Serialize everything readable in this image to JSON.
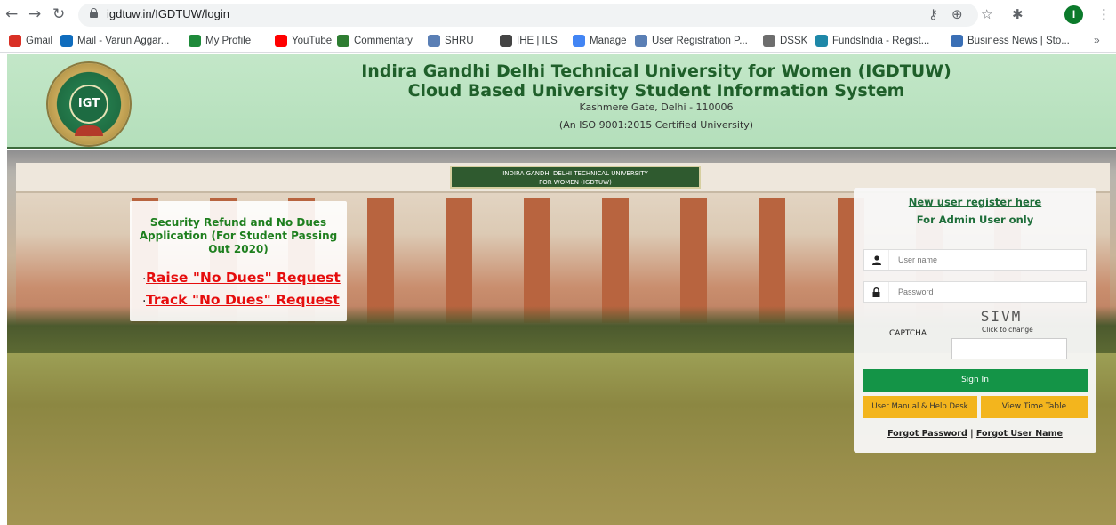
{
  "browser": {
    "url": "igdtuw.in/IGDTUW/login",
    "profile_initial": "I",
    "more_bookmarks": "»",
    "bookmarks": [
      {
        "label": "Gmail",
        "icon": "gmail-icon",
        "color": "#d93025"
      },
      {
        "label": "Mail - Varun Aggar...",
        "icon": "outlook-icon",
        "color": "#0f6cbd"
      },
      {
        "label": "My Profile",
        "icon": "profile-icon",
        "color": "#1e8a3a"
      },
      {
        "label": "YouTube",
        "icon": "youtube-icon",
        "color": "#ff0000"
      },
      {
        "label": "Commentary",
        "icon": "commentary-icon",
        "color": "#2e7d32"
      },
      {
        "label": "SHRU",
        "icon": "shru-icon",
        "color": "#5a7fb5"
      },
      {
        "label": "IHE | ILS",
        "icon": "globe-icon",
        "color": "#444444"
      },
      {
        "label": "Manage",
        "icon": "manage-icon",
        "color": "#4285f4"
      },
      {
        "label": "User Registration P...",
        "icon": "registration-icon",
        "color": "#5a7fb5"
      },
      {
        "label": "DSSK",
        "icon": "dssk-icon",
        "color": "#6d6d6d"
      },
      {
        "label": "FundsIndia - Regist...",
        "icon": "fundsindia-icon",
        "color": "#1e88a8"
      },
      {
        "label": "Business News | Sto...",
        "icon": "news-icon",
        "color": "#3a6fb5"
      }
    ]
  },
  "header": {
    "title1": "Indira Gandhi Delhi Technical University for Women (IGDTUW)",
    "title2": "Cloud Based University Student Information System",
    "address": "Kashmere Gate, Delhi - 110006",
    "certification": "(An ISO 9001:2015 Certified University)",
    "logo_text": "IGDTUW",
    "building_sign_line1": "INDIRA GANDHI DELHI TECHNICAL UNIVERSITY",
    "building_sign_line2": "FOR WOMEN (IGDTUW)"
  },
  "notice": {
    "title": "Security Refund and No Dues Application (For Student Passing Out 2020)",
    "bullet": ".",
    "link1": "Raise \"No Dues\" Request",
    "link2": "Track \"No Dues\" Request"
  },
  "login": {
    "register_link": "New user register here",
    "admin_only": "For Admin User only",
    "username_placeholder": "User name",
    "password_placeholder": "Password",
    "captcha_label": "CAPTCHA",
    "captcha_text": "SIVM",
    "captcha_hint": "Click to change",
    "signin": "Sign In",
    "manual": "User Manual & Help Desk",
    "timetable": "View Time Table",
    "forgot_password": "Forgot Password",
    "separator": "|",
    "forgot_username": "Forgot User Name"
  }
}
